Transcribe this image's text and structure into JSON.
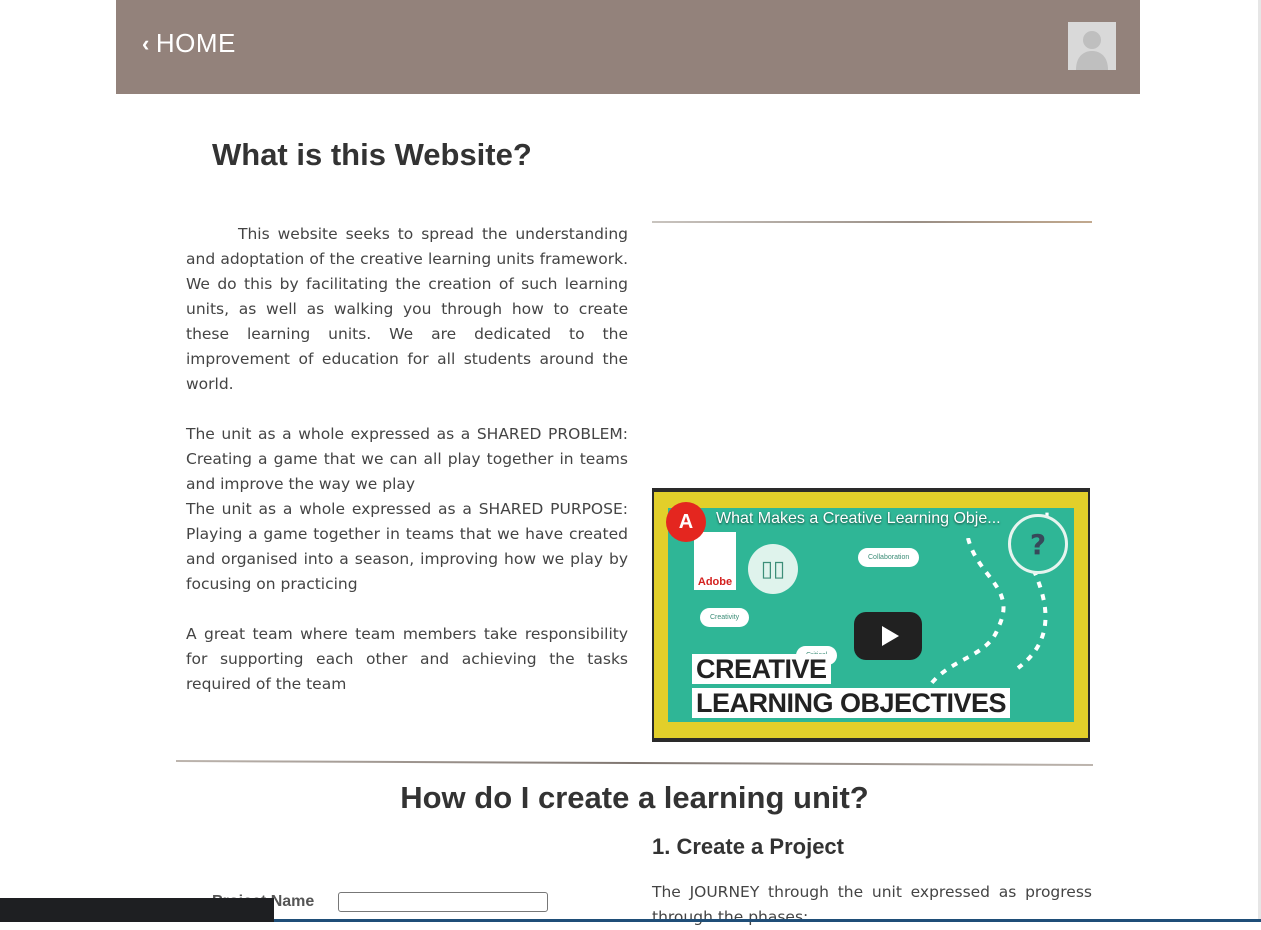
{
  "header": {
    "home_label": "HOME",
    "avatar_icon": "user-avatar-icon"
  },
  "intro": {
    "title": "What is this Website?",
    "paragraph1": "This website seeks to spread the understanding and adoptation of the creative learning units framework. We do this by facilitating the creation of such learning units, as well as walking you through how to create these learning units. We are dedicated to the improvement of education for all students around the world.",
    "paragraph2": "The unit as a whole expressed as a SHARED PROBLEM: Creating a game that we can all play together in teams and improve the way we play",
    "paragraph3": "The unit as a whole expressed as a SHARED PURPOSE: Playing a game together in teams that we have created and organised into a season, improving how we play by focusing on practicing",
    "paragraph4": "A great team where team members take responsibility for supporting each other and achieving the tasks required of the team"
  },
  "video": {
    "title": "What Makes a Creative Learning Obje...",
    "brand": "Adobe",
    "overlay_line1": "CREATIVE",
    "overlay_line2": "LEARNING OBJECTIVES",
    "tag_collaboration": "Collaboration",
    "tag_creativity": "Creativity",
    "tag_critical": "Critical",
    "help_symbol": "?"
  },
  "howto": {
    "title": "How do I create a learning unit?",
    "step1_title": "1. Create a Project",
    "step1_text": "The JOURNEY through the unit expressed as progress through the phases:",
    "form_label": "Project Name"
  }
}
